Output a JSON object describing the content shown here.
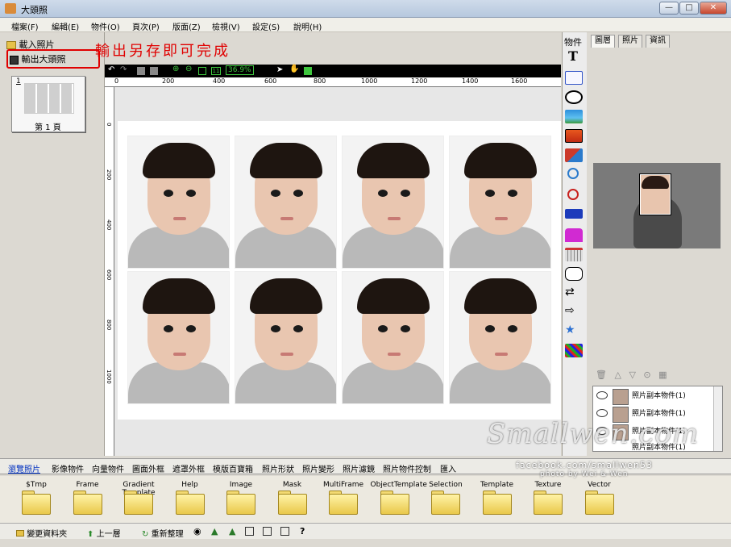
{
  "window": {
    "title": "大頭照",
    "minimize": "—",
    "maximize": "□",
    "close": "✕"
  },
  "menu": [
    "檔案(F)",
    "編輯(E)",
    "物件(O)",
    "頁次(P)",
    "版面(Z)",
    "檢視(V)",
    "設定(S)",
    "說明(H)"
  ],
  "left_panel": {
    "load_photo": "載入照片",
    "export_photo": "輸出大頭照",
    "page_index": "1",
    "page_label": "第 1 頁"
  },
  "annotation": "輸出另存即可完成",
  "toolbar": {
    "zoom_value": "36.9%"
  },
  "ruler": {
    "h_ticks": [
      "0",
      "200",
      "400",
      "600",
      "800",
      "1000",
      "1200",
      "1400",
      "1600"
    ],
    "v_ticks": [
      "0",
      "200",
      "400",
      "600",
      "800",
      "1000"
    ]
  },
  "object_toolbar": {
    "header": "物件",
    "text_tool": "T"
  },
  "right_panel": {
    "tabs": [
      "圖層",
      "照片",
      "資訊"
    ],
    "layers": [
      "照片副本物件(1)",
      "照片副本物件(1)",
      "照片副本物件(1)",
      "照片副本物件(1)"
    ]
  },
  "bottom_tabs": [
    "瀏覽照片",
    "影像物件",
    "向量物件",
    "圖面外框",
    "遮罩外框",
    "模版百寶箱",
    "照片形狀",
    "照片變形",
    "照片濾鏡",
    "照片物件控制",
    "匯入"
  ],
  "folders": [
    "$Tmp",
    "Frame",
    "Gradient Template",
    "Help",
    "Image",
    "Mask",
    "MultiFrame",
    "ObjectTemplate",
    "Selection",
    "Template",
    "Texture",
    "Vector"
  ],
  "status_bar": {
    "change_folder": "變更資料夾",
    "up_level": "上一層",
    "refresh": "重新整理",
    "help": "?"
  },
  "watermark": {
    "brand": "Smallwen.com",
    "line2": "facebook.com/smallwen53",
    "line3": "photo by Wei & Wen"
  }
}
